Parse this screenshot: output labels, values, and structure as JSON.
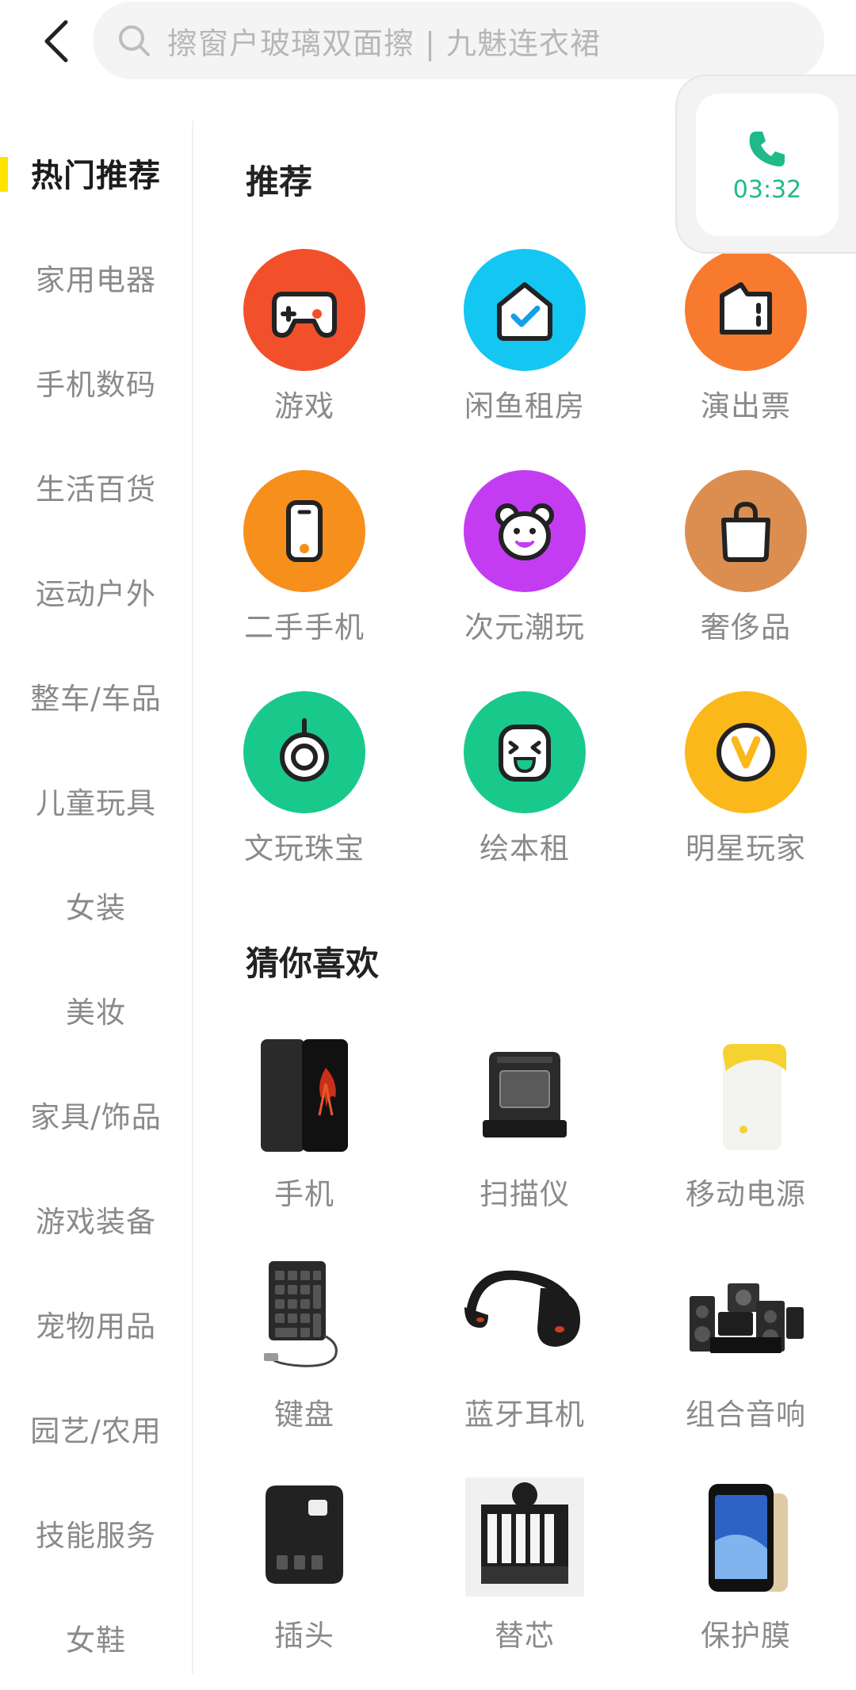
{
  "header": {
    "back_icon": "chevron-left-icon",
    "search_icon": "search-icon",
    "search_placeholder": "擦窗户玻璃双面擦 | 九魅连衣裙"
  },
  "call": {
    "icon": "phone-icon",
    "time": "03:32",
    "color": "#1fb98a"
  },
  "sidebar": {
    "active_color": "#ffe200",
    "items": [
      {
        "label": "热门推荐",
        "active": true
      },
      {
        "label": "家用电器"
      },
      {
        "label": "手机数码"
      },
      {
        "label": "生活百货"
      },
      {
        "label": "运动户外"
      },
      {
        "label": "整车/车品"
      },
      {
        "label": "儿童玩具"
      },
      {
        "label": "女装"
      },
      {
        "label": "美妆"
      },
      {
        "label": "家具/饰品"
      },
      {
        "label": "游戏装备"
      },
      {
        "label": "宠物用品"
      },
      {
        "label": "园艺/农用"
      },
      {
        "label": "技能服务"
      },
      {
        "label": "女鞋"
      }
    ]
  },
  "recommend": {
    "title": "推荐",
    "items": [
      {
        "label": "游戏",
        "icon": "gamepad-icon",
        "color": "#f2502a"
      },
      {
        "label": "闲鱼租房",
        "icon": "house-check-icon",
        "color": "#14c6f2"
      },
      {
        "label": "演出票",
        "icon": "ticket-icon",
        "color": "#f77a2e"
      },
      {
        "label": "二手手机",
        "icon": "phone-device-icon",
        "color": "#f78f1c"
      },
      {
        "label": "次元潮玩",
        "icon": "bear-icon",
        "color": "#c43cf2"
      },
      {
        "label": "奢侈品",
        "icon": "bag-icon",
        "color": "#dc8e50"
      },
      {
        "label": "文玩珠宝",
        "icon": "ring-icon",
        "color": "#19c98b"
      },
      {
        "label": "绘本租",
        "icon": "smile-face-icon",
        "color": "#19c98b"
      },
      {
        "label": "明星玩家",
        "icon": "v-star-icon",
        "color": "#fbb81a"
      }
    ]
  },
  "guess": {
    "title": "猜你喜欢",
    "items": [
      {
        "label": "手机",
        "icon": "smartphone-product-icon"
      },
      {
        "label": "扫描仪",
        "icon": "scanner-product-icon"
      },
      {
        "label": "移动电源",
        "icon": "power-bank-product-icon"
      },
      {
        "label": "键盘",
        "icon": "keypad-product-icon"
      },
      {
        "label": "蓝牙耳机",
        "icon": "headset-product-icon"
      },
      {
        "label": "组合音响",
        "icon": "speakers-product-icon"
      },
      {
        "label": "插头",
        "icon": "plug-adapter-product-icon"
      },
      {
        "label": "替芯",
        "icon": "refill-product-icon"
      },
      {
        "label": "保护膜",
        "icon": "screen-protector-product-icon"
      }
    ]
  }
}
